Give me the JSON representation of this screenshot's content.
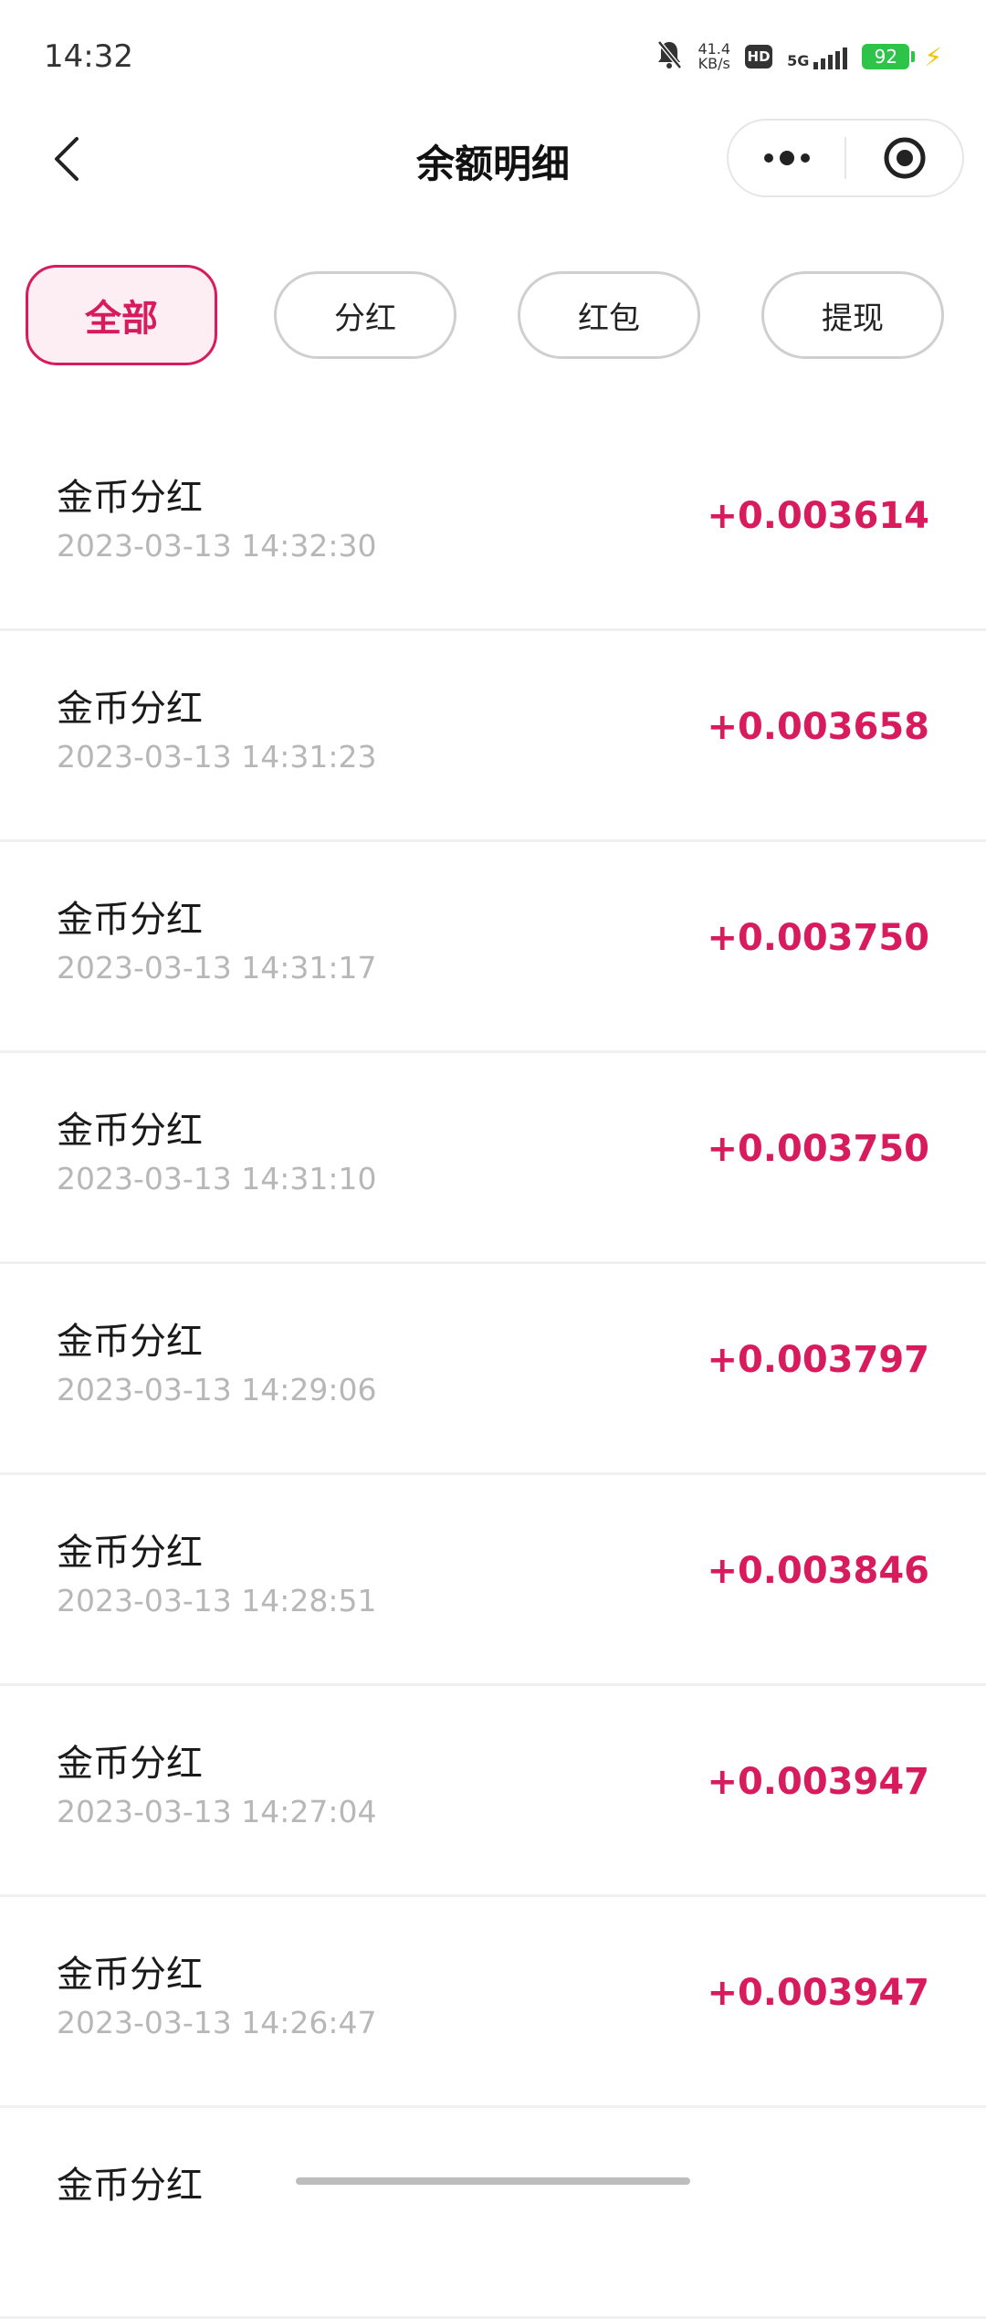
{
  "status_bar": {
    "time": "14:32",
    "net_speed_value": "41.4",
    "net_speed_unit": "KB/s",
    "hd": "HD",
    "network": "5G",
    "battery": "92"
  },
  "nav": {
    "title": "余额明细"
  },
  "tabs": [
    {
      "label": "全部",
      "active": true
    },
    {
      "label": "分红",
      "active": false
    },
    {
      "label": "红包",
      "active": false
    },
    {
      "label": "提现",
      "active": false
    }
  ],
  "records": [
    {
      "title": "金币分红",
      "time": "2023-03-13 14:32:30",
      "amount": "+0.003614"
    },
    {
      "title": "金币分红",
      "time": "2023-03-13 14:31:23",
      "amount": "+0.003658"
    },
    {
      "title": "金币分红",
      "time": "2023-03-13 14:31:17",
      "amount": "+0.003750"
    },
    {
      "title": "金币分红",
      "time": "2023-03-13 14:31:10",
      "amount": "+0.003750"
    },
    {
      "title": "金币分红",
      "time": "2023-03-13 14:29:06",
      "amount": "+0.003797"
    },
    {
      "title": "金币分红",
      "time": "2023-03-13 14:28:51",
      "amount": "+0.003846"
    },
    {
      "title": "金币分红",
      "time": "2023-03-13 14:27:04",
      "amount": "+0.003947"
    },
    {
      "title": "金币分红",
      "time": "2023-03-13 14:26:47",
      "amount": "+0.003947"
    },
    {
      "title": "金币分红",
      "time": "",
      "amount": ""
    }
  ],
  "colors": {
    "accent": "#d81b5d",
    "accent_bg": "#fdeef3",
    "time_text": "#b7b7b7"
  }
}
